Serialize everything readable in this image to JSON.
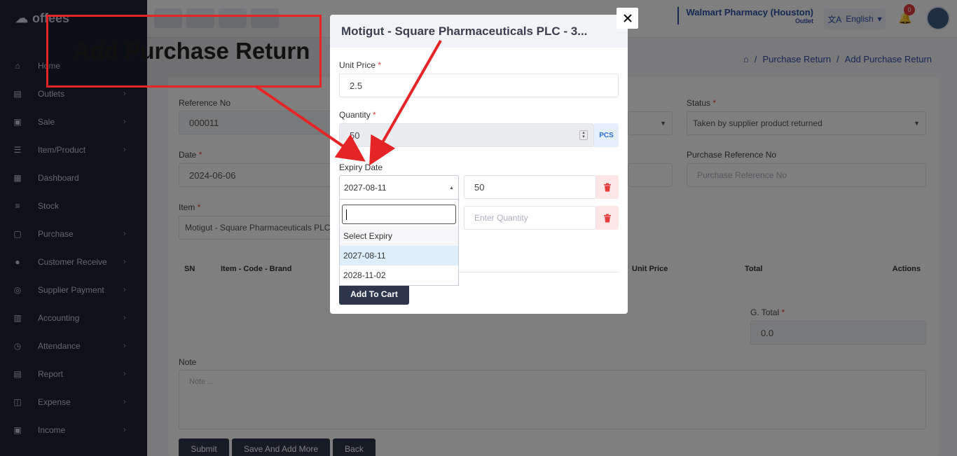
{
  "sidebar": {
    "logo": "offees",
    "items": [
      {
        "label": "Home",
        "icon": "home-icon",
        "chevron": false
      },
      {
        "label": "Outlets",
        "icon": "store-icon",
        "chevron": true
      },
      {
        "label": "Sale",
        "icon": "cart-icon",
        "chevron": true
      },
      {
        "label": "Item/Product",
        "icon": "list-icon",
        "chevron": true
      },
      {
        "label": "Dashboard",
        "icon": "dashboard-icon",
        "chevron": false
      },
      {
        "label": "Stock",
        "icon": "database-icon",
        "chevron": false
      },
      {
        "label": "Purchase",
        "icon": "bag-icon",
        "chevron": true
      },
      {
        "label": "Customer Receive",
        "icon": "user-icon",
        "chevron": true
      },
      {
        "label": "Supplier Payment",
        "icon": "users-icon",
        "chevron": true
      },
      {
        "label": "Accounting",
        "icon": "bank-icon",
        "chevron": true
      },
      {
        "label": "Attendance",
        "icon": "clock-icon",
        "chevron": true
      },
      {
        "label": "Report",
        "icon": "report-icon",
        "chevron": true
      },
      {
        "label": "Expense",
        "icon": "wallet-icon",
        "chevron": true
      },
      {
        "label": "Income",
        "icon": "income-icon",
        "chevron": true
      }
    ]
  },
  "header": {
    "outlet_name": "Walmart Pharmacy (Houston)",
    "outlet_sub": "Outlet",
    "language": "English",
    "notification_count": "0"
  },
  "breadcrumb": {
    "items": [
      "Purchase Return",
      "Add Purchase Return"
    ]
  },
  "page": {
    "title": "Add Purchase Return"
  },
  "form": {
    "reference_label": "Reference No",
    "reference_value": "000011",
    "status_label": "Status",
    "status_value": "Taken by supplier product returned",
    "date_label": "Date",
    "date_value": "2024-06-06",
    "purchase_ref_label": "Purchase Reference No",
    "purchase_ref_placeholder": "Purchase Reference No",
    "item_label": "Item",
    "item_value": "Motigut - Square Pharmaceuticals PLC",
    "table_headers": [
      "SN",
      "Item - Code - Brand",
      "Unit Price",
      "Total",
      "Actions"
    ],
    "gtotal_label": "G. Total",
    "gtotal_value": "0.0",
    "note_label": "Note",
    "note_placeholder": "Note ...",
    "buttons": [
      "Submit",
      "Save And Add More",
      "Back"
    ]
  },
  "modal": {
    "title": "Motigut - Square Pharmaceuticals PLC - 3...",
    "unit_price_label": "Unit Price",
    "unit_price_value": "2.5",
    "quantity_label": "Quantity",
    "quantity_value": "50",
    "quantity_unit": "PCS",
    "expiry_label": "Expiry Date",
    "expiry_selected": "2027-08-11",
    "row1_qty": "50",
    "row2_qty_placeholder": "Enter Quantity",
    "dropdown_options": [
      "Select Expiry",
      "2027-08-11",
      "2028-11-02"
    ],
    "add_to_cart": "Add To Cart",
    "close_icon": "close-icon"
  },
  "annotation": {
    "callout_text": "Add Purchase Return",
    "color": "#e52525"
  }
}
